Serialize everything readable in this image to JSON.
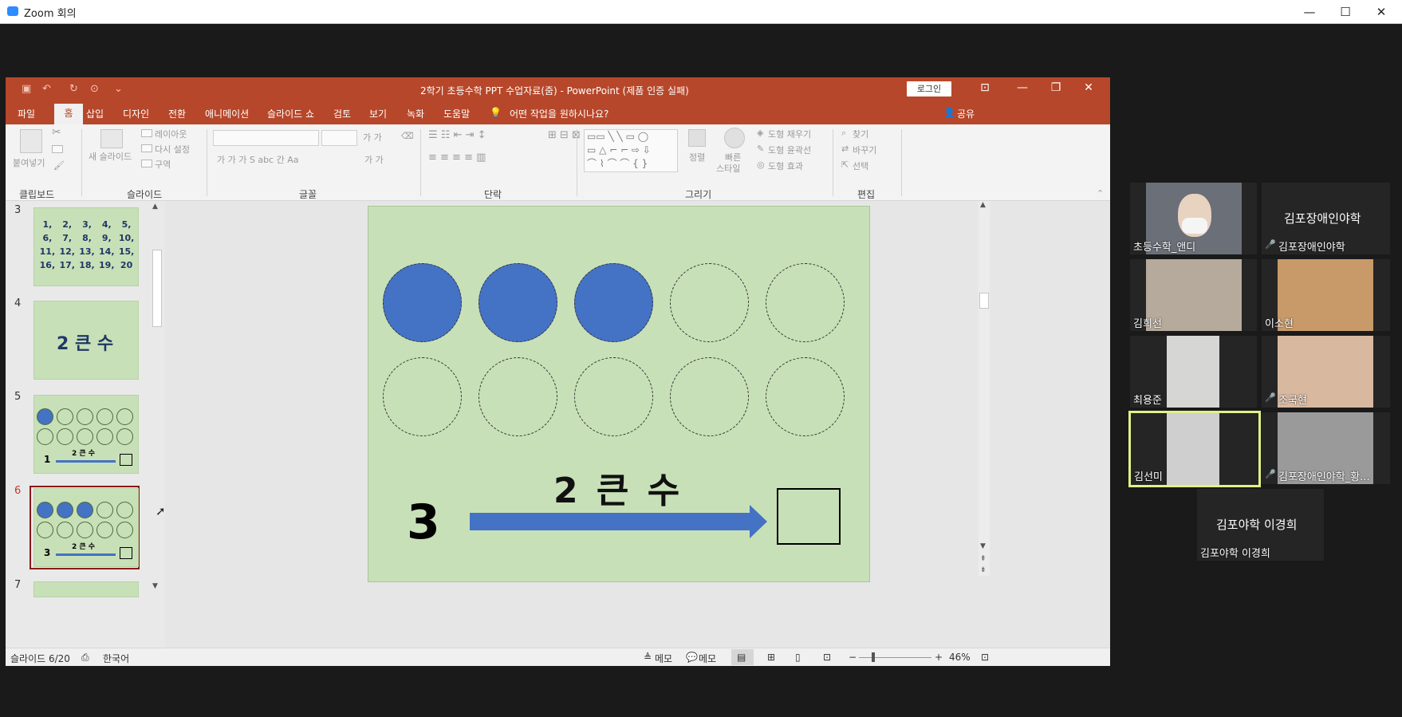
{
  "zoom": {
    "title": "Zoom 회의",
    "min": "—",
    "max": "☐",
    "close": "✕"
  },
  "ppt": {
    "doc_title": "2학기 초등수학 PPT 수업자료(줌)  -  PowerPoint (제품 인증 실패)",
    "login": "로그인",
    "menus": [
      "파일",
      "홈",
      "삽입",
      "디자인",
      "전환",
      "애니메이션",
      "슬라이드 쇼",
      "검토",
      "보기",
      "녹화",
      "도움말"
    ],
    "tell_me": "어떤 작업을 원하시나요?",
    "share": "공유",
    "ribbon": {
      "clipboard": {
        "label": "클립보드",
        "paste": "붙여넣기"
      },
      "slides": {
        "label": "슬라이드",
        "new_slide": "새 슬라이드",
        "layout": "레이아웃",
        "reset": "다시 설정",
        "section": "구역"
      },
      "font": {
        "label": "글꼴"
      },
      "paragraph": {
        "label": "단락"
      },
      "drawing": {
        "label": "그리기",
        "arrange": "정렬",
        "quick_styles": "빠른",
        "quick_styles2": "스타일",
        "fill": "도형 채우기",
        "outline": "도형 윤곽선",
        "effects": "도형 효과"
      },
      "editing": {
        "label": "편집",
        "find": "찾기",
        "replace": "바꾸기",
        "select": "선택"
      }
    },
    "thumbs": {
      "n3": "3",
      "n4": "4",
      "n5": "5",
      "n6": "6",
      "n7": "7",
      "grid_numbers": [
        "1,",
        "2,",
        "3,",
        "4,",
        "5,",
        "6,",
        "7,",
        "8,",
        "9,",
        "10,",
        "11,",
        "12,",
        "13,",
        "14,",
        "15,",
        "16,",
        "17,",
        "18,",
        "19,",
        "20"
      ],
      "t4_title": "2 큰 수",
      "t5_number": "1",
      "t5_label": "2 큰 수",
      "t6_number": "3",
      "t6_label": "2 큰 수"
    },
    "slide": {
      "heading": "2 큰 수",
      "number": "3",
      "filled_circles": 3,
      "total_circles": 10
    },
    "status": {
      "slide_pos": "슬라이드 6/20",
      "language": "한국어",
      "notes": "메모",
      "comments": "메모",
      "zoom": "46%"
    }
  },
  "participants": [
    {
      "name": "초등수학_앤디",
      "muted": false,
      "video": true
    },
    {
      "name": "김포장애인야학",
      "display": "김포장애인야학",
      "muted": true,
      "video": false
    },
    {
      "name": "김희선",
      "muted": false,
      "video": true
    },
    {
      "name": "이소현",
      "muted": false,
      "video": true
    },
    {
      "name": "최용준",
      "muted": false,
      "video": true
    },
    {
      "name": "조국현",
      "muted": true,
      "video": true
    },
    {
      "name": "김선미",
      "muted": false,
      "video": true,
      "speaking": true
    },
    {
      "name": "김포장애인야학_황...",
      "muted": true,
      "video": true
    },
    {
      "name": "김포야학 이경희",
      "display": "김포야학 이경희",
      "muted": false,
      "video": false
    }
  ],
  "colors": {
    "ppt_red": "#b7472a",
    "slide_green": "#c8e0b8",
    "circle_blue": "#4472c4",
    "speaker_border": "#e1f08a"
  }
}
